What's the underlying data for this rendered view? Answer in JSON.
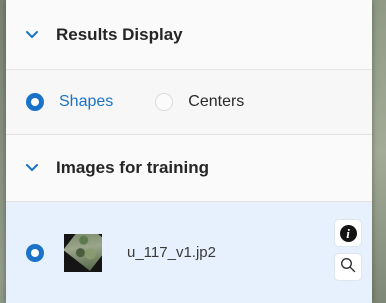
{
  "results_display": {
    "title": "Results Display",
    "options": [
      {
        "label": "Shapes",
        "selected": true
      },
      {
        "label": "Centers",
        "selected": false
      }
    ]
  },
  "images_for_training": {
    "title": "Images for training",
    "items": [
      {
        "file_name": "u_117_v1.jp2",
        "selected": true
      }
    ]
  },
  "icons": {
    "collapse": "chevron-down-icon",
    "info": "info-icon",
    "search": "search-icon"
  },
  "colors": {
    "accent": "#1a73c8",
    "selected_row_bg": "#e6f1fd",
    "panel_bg": "#f4f4f4"
  }
}
